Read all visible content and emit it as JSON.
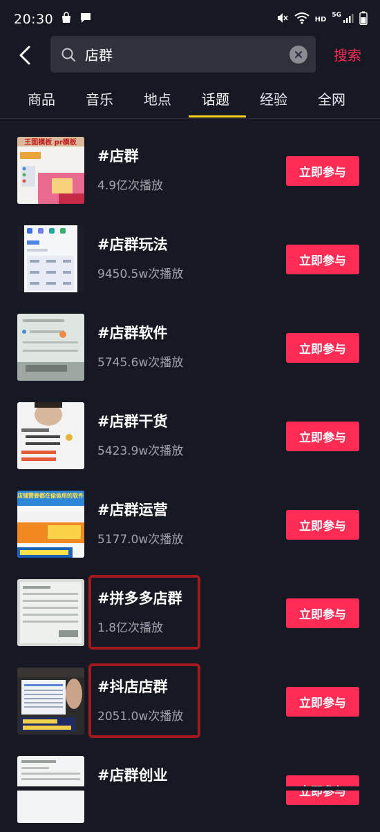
{
  "status_bar": {
    "time": "20:30",
    "hd_label": "HD",
    "network_label": "5G"
  },
  "search": {
    "query": "店群",
    "action_label": "搜索"
  },
  "tabs": [
    {
      "label": "商品",
      "active": false
    },
    {
      "label": "音乐",
      "active": false
    },
    {
      "label": "地点",
      "active": false
    },
    {
      "label": "话题",
      "active": true
    },
    {
      "label": "经验",
      "active": false
    },
    {
      "label": "全网",
      "active": false
    }
  ],
  "topics": [
    {
      "title": "#店群",
      "plays": "4.9亿次播放",
      "button": "立即参与",
      "thumb_caption": "王图模板 pr模板",
      "highlighted": false
    },
    {
      "title": "#店群玩法",
      "plays": "9450.5w次播放",
      "button": "立即参与",
      "thumb_caption": "",
      "highlighted": false
    },
    {
      "title": "#店群软件",
      "plays": "5745.6w次播放",
      "button": "立即参与",
      "thumb_caption": "",
      "highlighted": false
    },
    {
      "title": "#店群干货",
      "plays": "5423.9w次播放",
      "button": "立即参与",
      "thumb_caption": "",
      "highlighted": false
    },
    {
      "title": "#店群运营",
      "plays": "5177.0w次播放",
      "button": "立即参与",
      "thumb_caption": "店铺需要都在偷偷用的软件",
      "highlighted": false
    },
    {
      "title": "#拼多多店群",
      "plays": "1.8亿次播放",
      "button": "立即参与",
      "thumb_caption": "",
      "highlighted": true
    },
    {
      "title": "#抖店店群",
      "plays": "2051.0w次播放",
      "button": "立即参与",
      "thumb_caption": "",
      "highlighted": true
    },
    {
      "title": "#店群创业",
      "plays": "",
      "button": "立即参与",
      "thumb_caption": "",
      "highlighted": false
    }
  ],
  "colors": {
    "background": "#161823",
    "accent": "#fe2c55",
    "tab_indicator": "#fdd11d",
    "highlight_annotation": "#a3191d"
  }
}
